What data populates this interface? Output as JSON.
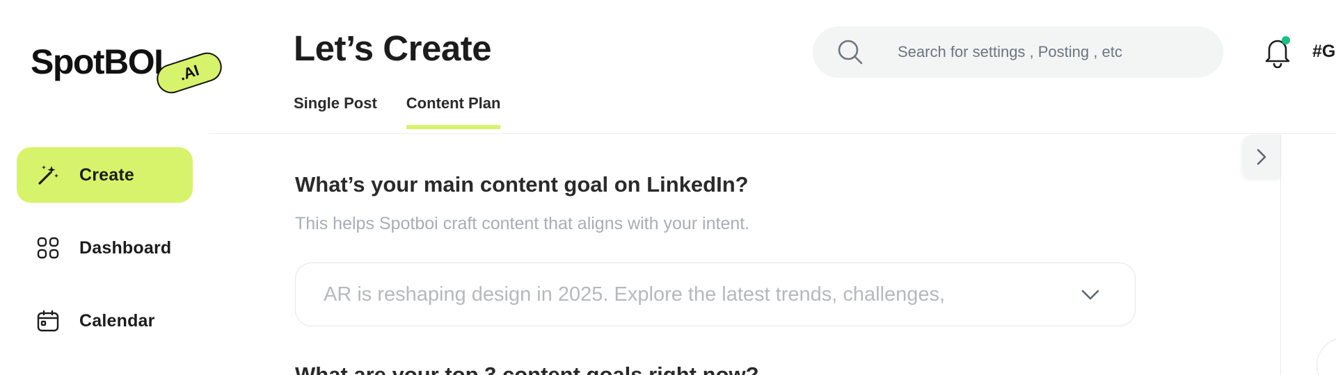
{
  "brand": {
    "name": "SpotBOI",
    "badge": ".AI"
  },
  "sidebar": {
    "items": [
      {
        "label": "Create",
        "icon": "magic-wand-icon",
        "active": true
      },
      {
        "label": "Dashboard",
        "icon": "grid-icon",
        "active": false
      },
      {
        "label": "Calendar",
        "icon": "calendar-icon",
        "active": false
      }
    ]
  },
  "header": {
    "title": "Let’s Create",
    "search_placeholder": "Search for settings , Posting , etc",
    "handle": "#G"
  },
  "tabs": [
    {
      "label": "Single Post",
      "active": false
    },
    {
      "label": "Content Plan",
      "active": true
    }
  ],
  "main": {
    "question1": "What’s your main content goal on LinkedIn?",
    "question1_help": "This helps Spotboi craft content that aligns with your intent.",
    "goal_select_value": "AR is reshaping design in 2025. Explore the latest trends, challenges,",
    "question2": "What are your top 3 content goals right now?"
  },
  "colors": {
    "accent": "#d7f36b",
    "notification_dot": "#1bc085",
    "muted_text": "#a9aeb2"
  }
}
